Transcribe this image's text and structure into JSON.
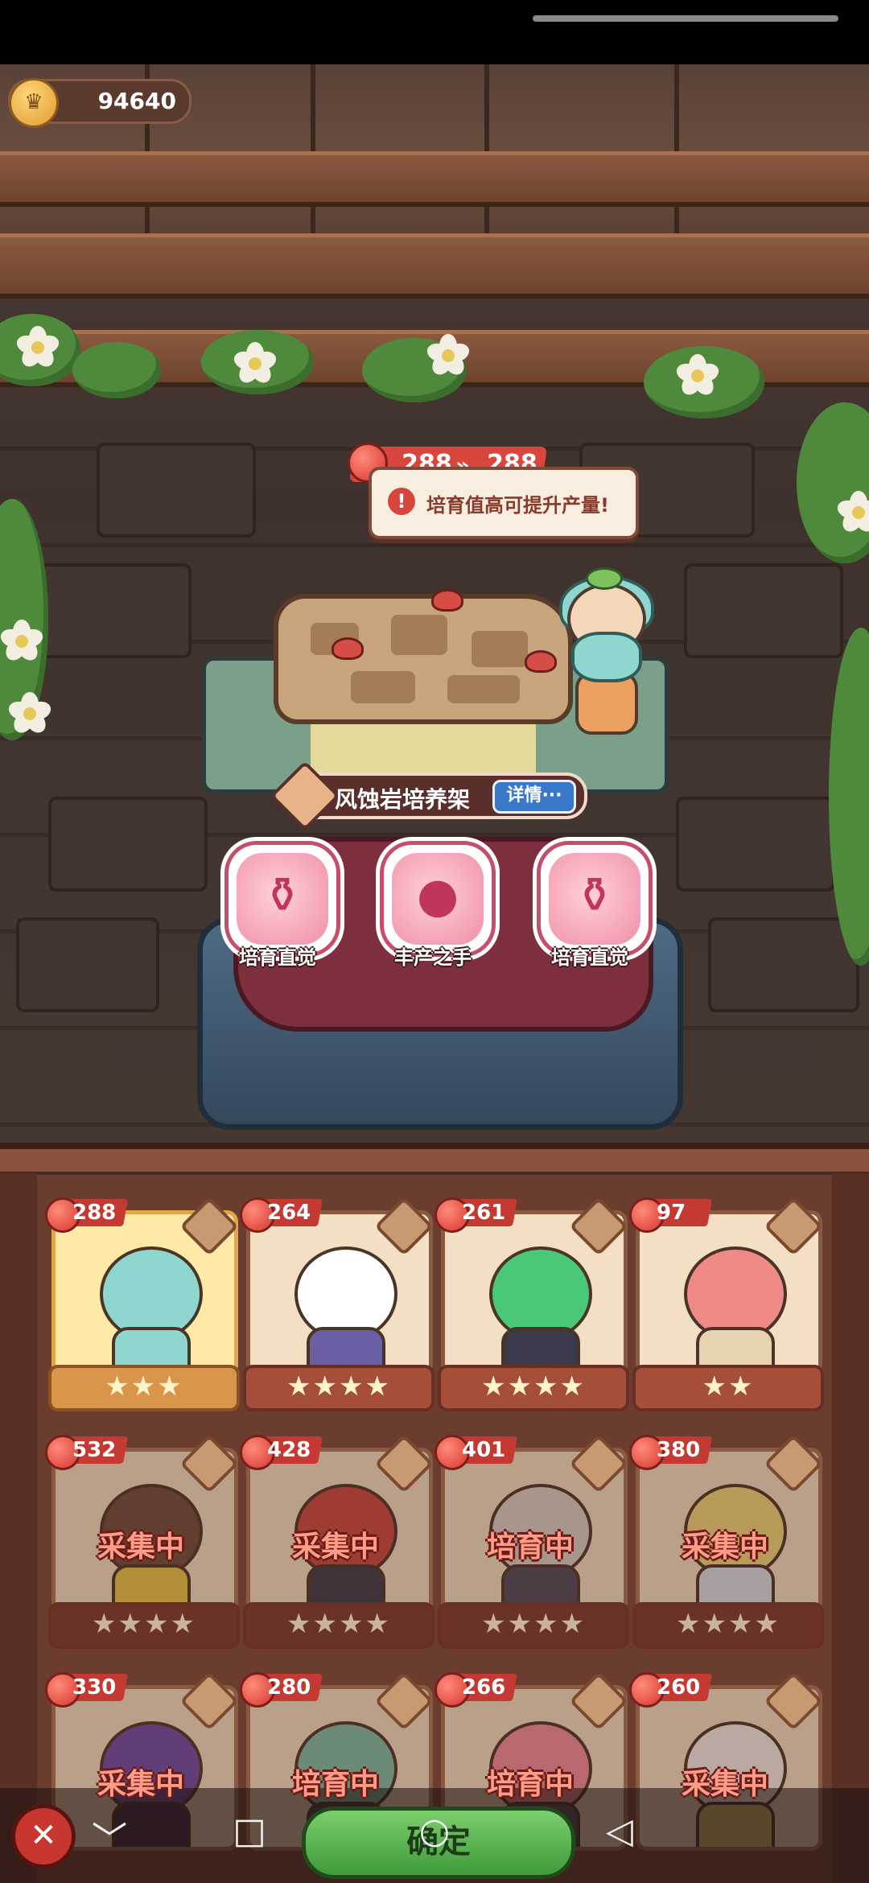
{
  "currency": {
    "value": "94640",
    "icon": "crown-coin-icon"
  },
  "growth": {
    "current": "288",
    "next": "288",
    "arrows": "»",
    "tip": "培育值高可提升产量!"
  },
  "station": {
    "name": "风蚀岩培养架",
    "detail_label": "详情···"
  },
  "skills": [
    {
      "label": "培育直觉",
      "icon": "watering-can-icon"
    },
    {
      "label": "丰产之手",
      "icon": "apple-hand-icon"
    },
    {
      "label": "培育直觉",
      "icon": "watering-can-icon"
    }
  ],
  "cards": [
    {
      "value": "288",
      "stars": "★★★",
      "status": "",
      "active": true,
      "color": "#8fd6cf"
    },
    {
      "value": "264",
      "stars": "★★★★",
      "status": "",
      "active": false,
      "color": "#ffffff"
    },
    {
      "value": "261",
      "stars": "★★★★",
      "status": "",
      "active": false,
      "color": "#49c878"
    },
    {
      "value": "97",
      "stars": "★★",
      "status": "",
      "active": false,
      "color": "#f08a86"
    },
    {
      "value": "532",
      "stars": "★★★★",
      "status": "采集中",
      "active": false,
      "color": "#6b4a3a"
    },
    {
      "value": "428",
      "stars": "★★★★",
      "status": "采集中",
      "active": false,
      "color": "#c8463e"
    },
    {
      "value": "401",
      "stars": "★★★★",
      "status": "培育中",
      "active": false,
      "color": "#d8d0c8"
    },
    {
      "value": "380",
      "stars": "★★★★",
      "status": "采集中",
      "active": false,
      "color": "#f0d77a"
    },
    {
      "value": "330",
      "stars": "",
      "status": "采集中",
      "active": false,
      "color": "#6a4aa8"
    },
    {
      "value": "280",
      "stars": "",
      "status": "培育中",
      "active": false,
      "color": "#7cc0a8"
    },
    {
      "value": "266",
      "stars": "",
      "status": "培育中",
      "active": false,
      "color": "#f08a9a"
    },
    {
      "value": "260",
      "stars": "",
      "status": "采集中",
      "active": false,
      "color": "#f3efe6"
    }
  ],
  "bottom": {
    "close_label": "✕",
    "confirm_label": "确定"
  },
  "nav": {
    "down": "﹀",
    "square": "□",
    "home": "○",
    "back": "◁"
  }
}
